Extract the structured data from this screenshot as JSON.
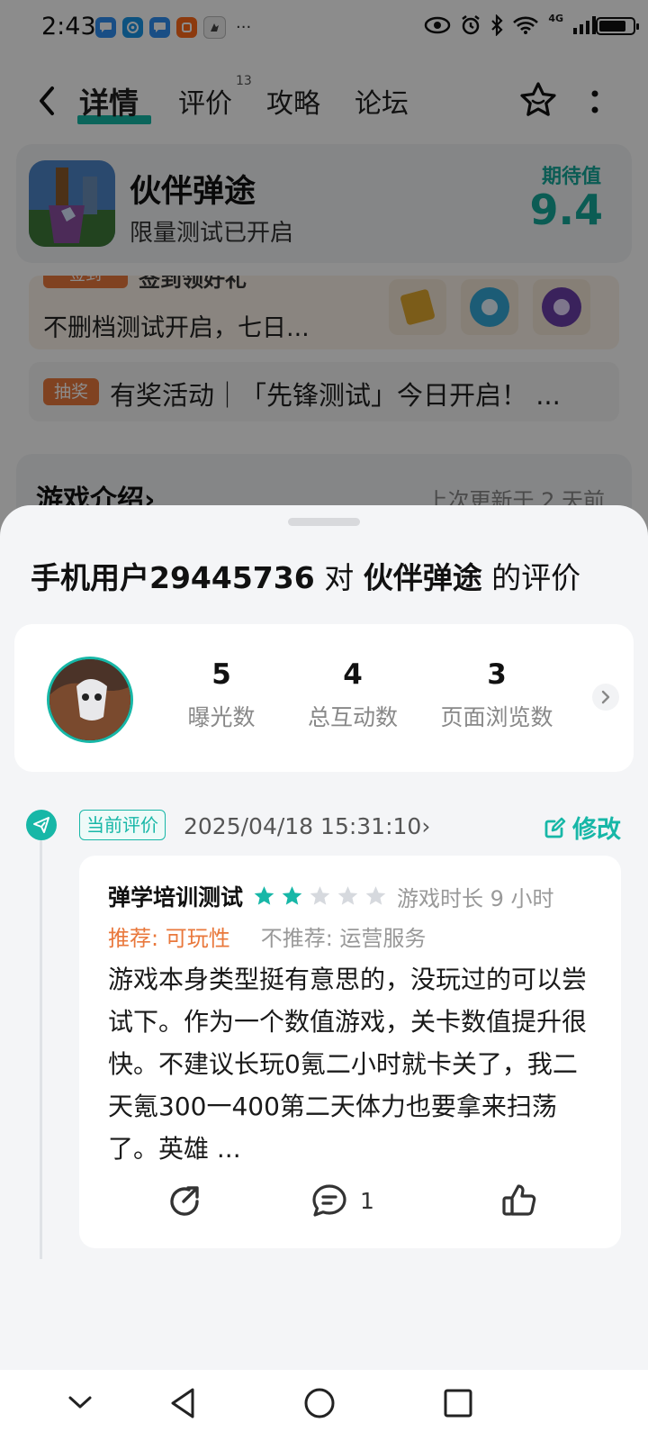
{
  "status_bar": {
    "time": "2:43",
    "more": "···",
    "network": "4G",
    "battery_level": 0.85,
    "notification_icons": [
      "chat-icon",
      "qq-icon",
      "message-icon",
      "taobao-icon",
      "game-app-icon"
    ]
  },
  "nav": {
    "tabs": [
      {
        "label": "详情",
        "active": true
      },
      {
        "label": "评价",
        "badge": "13"
      },
      {
        "label": "攻略"
      },
      {
        "label": "论坛"
      }
    ]
  },
  "game": {
    "name": "伙伴弹途",
    "subtitle": "限量测试已开启",
    "expectation_label": "期待值",
    "expectation_value": "9.4"
  },
  "promo": {
    "badge": "签到",
    "title": "签到领好礼",
    "text": "不删档测试开启，七日..."
  },
  "activity": {
    "badge": "抽奖",
    "text": "有奖活动｜「先锋测试」今日开启！ ..."
  },
  "intro": {
    "title": "游戏介绍",
    "chevron": "›",
    "updated": "上次更新于 2 天前"
  },
  "sheet": {
    "user": "手机用户29445736",
    "connector": " 对 ",
    "game_name": "伙伴弹途",
    "suffix": " 的评价",
    "stats": [
      {
        "value": "5",
        "label": "曝光数"
      },
      {
        "value": "4",
        "label": "总互动数"
      },
      {
        "value": "3",
        "label": "页面浏览数"
      }
    ],
    "current_badge": "当前评价",
    "review_date": "2025/04/18 15:31:10",
    "date_chevron": "›",
    "edit_label": "修改",
    "review": {
      "reviewer": "弹学培训测试",
      "rating": 2,
      "max_rating": 5,
      "playtime": "游戏时长 9 小时",
      "recommend": "推荐: 可玩性",
      "not_recommend": "不推荐: 运营服务",
      "text": "游戏本身类型挺有意思的，没玩过的可以尝试下。作为一个数值游戏，关卡数值提升很快。不建议长玩0氪二小时就卡关了，我二天氪300一400第二天体力也要拿来扫荡了。英雄 ...",
      "comment_count": "1"
    }
  },
  "colors": {
    "accent": "#17b7a7",
    "orange": "#e9783c",
    "star_inactive": "#d6d9de"
  }
}
